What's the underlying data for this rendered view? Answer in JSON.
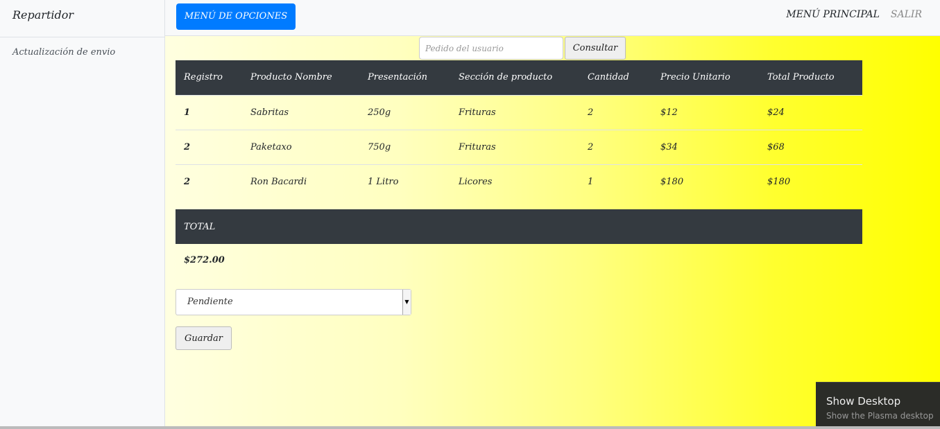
{
  "sidebar": {
    "brand": "Repartidor",
    "items": [
      {
        "label": "Actualización de envio"
      }
    ]
  },
  "topbar": {
    "menu_button": "MENÚ DE OPCIONES",
    "main_menu": "MENÚ PRINCIPAL",
    "logout": "SALIR"
  },
  "search": {
    "placeholder": "Pedido del usuario",
    "button": "Consultar"
  },
  "table": {
    "headers": [
      "Registro",
      "Producto Nombre",
      "Presentación",
      "Sección de producto",
      "Cantidad",
      "Precio Unitario",
      "Total Producto"
    ],
    "rows": [
      [
        "1",
        "Sabritas",
        "250g",
        "Frituras",
        "2",
        "$12",
        "$24"
      ],
      [
        "2",
        "Paketaxo",
        "750g",
        "Frituras",
        "2",
        "$34",
        "$68"
      ],
      [
        "2",
        "Ron Bacardi",
        "1 Litro",
        "Licores",
        "1",
        "$180",
        "$180"
      ]
    ]
  },
  "total": {
    "label": "TOTAL",
    "value": "$272.00"
  },
  "status": {
    "selected": "Pendiente"
  },
  "save_button": "Guardar",
  "tooltip": {
    "title": "Show Desktop",
    "subtitle": "Show the Plasma desktop"
  },
  "colors": {
    "primary": "#007bff",
    "table_header": "#343a40",
    "gradient_end": "#ffff00"
  }
}
